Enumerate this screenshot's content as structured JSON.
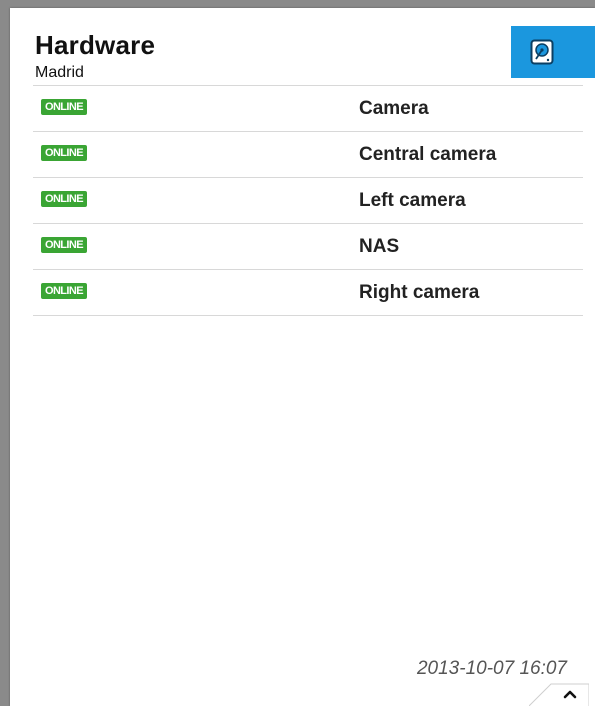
{
  "header": {
    "title": "Hardware",
    "location": "Madrid",
    "button_icon": "hard-drive-icon"
  },
  "devices": [
    {
      "status": "ONLINE",
      "name": "Camera"
    },
    {
      "status": "ONLINE",
      "name": "Central camera"
    },
    {
      "status": "ONLINE",
      "name": "Left camera"
    },
    {
      "status": "ONLINE",
      "name": "NAS"
    },
    {
      "status": "ONLINE",
      "name": "Right camera"
    }
  ],
  "footer": {
    "timestamp": "2013-10-07 16:07",
    "collapse_icon": "chevron-up-icon"
  },
  "colors": {
    "accent": "#1b97de",
    "online": "#3aa534"
  }
}
